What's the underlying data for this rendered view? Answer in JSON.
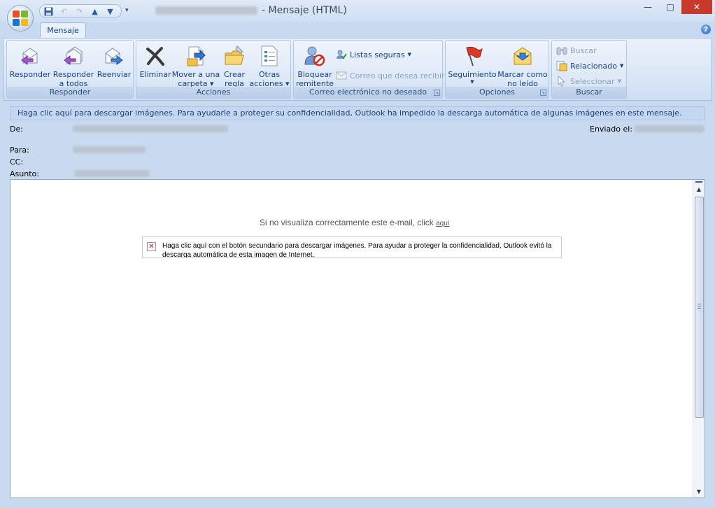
{
  "window": {
    "title_suffix": "- Mensaje (HTML)",
    "controls": {
      "minimize": "—",
      "maximize": "□",
      "close": "✕"
    }
  },
  "qat": {
    "icons": [
      "save-icon",
      "undo-icon",
      "redo-icon",
      "previous-item-icon",
      "next-item-icon",
      "customize-qat-icon"
    ],
    "more": "▾"
  },
  "tabs": [
    {
      "label": "Mensaje",
      "active": true
    }
  ],
  "help": {
    "label": "?"
  },
  "ribbon": {
    "responder": {
      "label": "Responder",
      "buttons": [
        {
          "line1": "Responder",
          "line2": ""
        },
        {
          "line1": "Responder",
          "line2": "a todos"
        },
        {
          "line1": "Reenviar",
          "line2": ""
        }
      ]
    },
    "acciones": {
      "label": "Acciones",
      "buttons": [
        {
          "line1": "Eliminar",
          "line2": ""
        },
        {
          "line1": "Mover a una",
          "line2": "carpeta ▾"
        },
        {
          "line1": "Crear",
          "line2": "regla"
        },
        {
          "line1": "Otras",
          "line2": "acciones ▾"
        }
      ]
    },
    "junk": {
      "label": "Correo electrónico no deseado",
      "block_line1": "Bloquear",
      "block_line2": "remitente",
      "safe_lists": "Listas seguras",
      "not_junk": "Correo que desea recibir"
    },
    "opciones": {
      "label": "Opciones",
      "followup": "Seguimiento",
      "mark_line1": "Marcar como",
      "mark_line2": "no leído"
    },
    "buscar": {
      "label": "Buscar",
      "find": "Buscar",
      "related": "Relacionado",
      "select": "Seleccionar"
    }
  },
  "infobar": {
    "text": "Haga clic aquí para descargar imágenes. Para ayudarle a proteger su confidencialidad, Outlook ha impedido la descarga automática de algunas imágenes en este mensaje."
  },
  "headers": {
    "from_label": "De:",
    "sent_label": "Enviado el:",
    "to_label": "Para:",
    "cc_label": "CC:",
    "subject_label": "Asunto:"
  },
  "body": {
    "notice_text": "Si no visualiza correctamente este e-mail, click",
    "notice_link": "aquí",
    "blocked_image_text": "Haga clic aquí con el botón secundario para descargar imágenes. Para ayudar a proteger la confidencialidad, Outlook evitó la descarga automática de esta imagen de Internet."
  },
  "colors": {
    "ribbon_text": "#15428b",
    "close_button": "#c7392b",
    "infobar": "#c4d7f0"
  }
}
